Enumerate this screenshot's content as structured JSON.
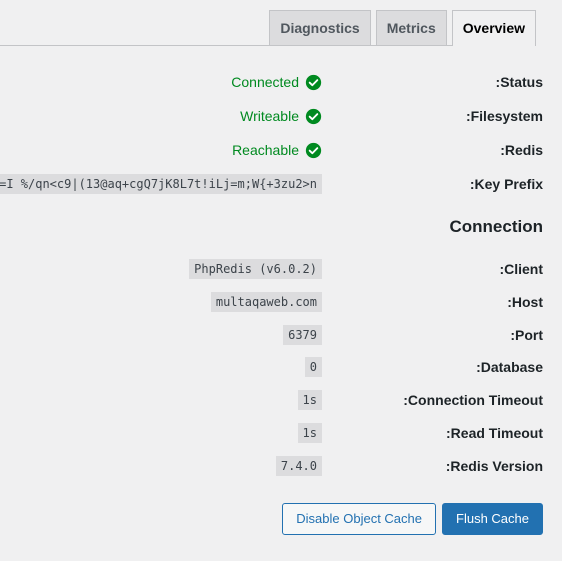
{
  "tabs": [
    {
      "label": "Diagnostics",
      "active": false
    },
    {
      "label": "Metrics",
      "active": false
    },
    {
      "label": "Overview",
      "active": true
    }
  ],
  "status_rows": {
    "status": {
      "label": ":Status",
      "value": "Connected",
      "icon": "check-circle-icon"
    },
    "filesystem": {
      "label": ":Filesystem",
      "value": "Writeable",
      "icon": "check-circle-icon"
    },
    "redis": {
      "label": ":Redis",
      "value": "Reachable",
      "icon": "check-circle-icon"
    }
  },
  "key_prefix": {
    "label": ":Key Prefix",
    "value": "=I %/qn<c9|(13@aq+cgQ7jK8L7t!iLj=m;W{+3zu2>n"
  },
  "connection": {
    "heading": "Connection",
    "client": {
      "label": ":Client",
      "value": "PhpRedis (v6.0.2)"
    },
    "host": {
      "label": ":Host",
      "value": "multaqaweb.com"
    },
    "port": {
      "label": ":Port",
      "value": "6379"
    },
    "database": {
      "label": ":Database",
      "value": "0"
    },
    "connection_timeout": {
      "label": ":Connection Timeout",
      "value": "1s"
    },
    "read_timeout": {
      "label": ":Read Timeout",
      "value": "1s"
    },
    "redis_version": {
      "label": ":Redis Version",
      "value": "7.4.0"
    }
  },
  "buttons": {
    "disable": "Disable Object Cache",
    "flush": "Flush Cache"
  },
  "colors": {
    "success": "#008a20",
    "primary": "#2271b1",
    "background": "#f0f0f1"
  }
}
